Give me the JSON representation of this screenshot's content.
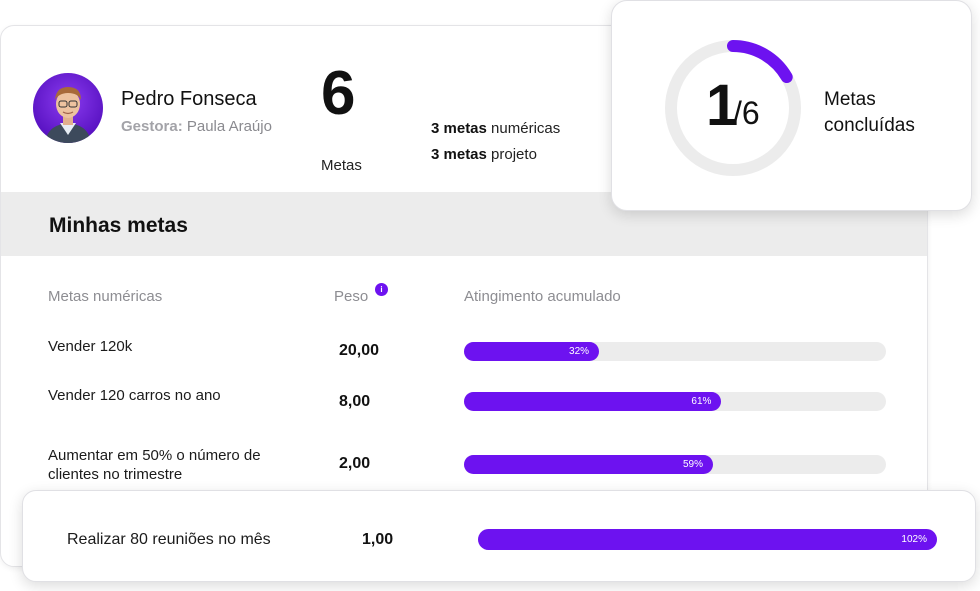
{
  "profile": {
    "name": "Pedro Fonseca",
    "manager_label": "Gestora:",
    "manager_name": "Paula Araújo",
    "goals_total": "6",
    "goals_label": "Metas",
    "numeric_count": "3 metas",
    "numeric_text": "numéricas",
    "project_count": "3 metas",
    "project_text": "projeto"
  },
  "summary": {
    "completed": "1",
    "total": "/6",
    "label_line1": "Metas",
    "label_line2": "concluídas",
    "completed_fraction": 0.1667,
    "accent_color": "#6d12f0"
  },
  "section": {
    "title": "Minhas metas"
  },
  "table": {
    "col_name": "Metas numéricas",
    "col_weight": "Peso",
    "col_progress": "Atingimento acumulado",
    "info_icon": "info-icon",
    "rows": [
      {
        "name": "Vender 120k",
        "weight": "20,00",
        "progress_label": "32%",
        "progress": 0.32
      },
      {
        "name": "Vender 120 carros no ano",
        "weight": "8,00",
        "progress_label": "61%",
        "progress": 0.61
      },
      {
        "name": "Aumentar em 50% o número de clientes no trimestre",
        "weight": "2,00",
        "progress_label": "59%",
        "progress": 0.59
      }
    ],
    "highlight": {
      "name": "Realizar 80 reuniões no mês",
      "weight": "1,00",
      "progress_label": "102%",
      "progress": 1.02
    }
  }
}
